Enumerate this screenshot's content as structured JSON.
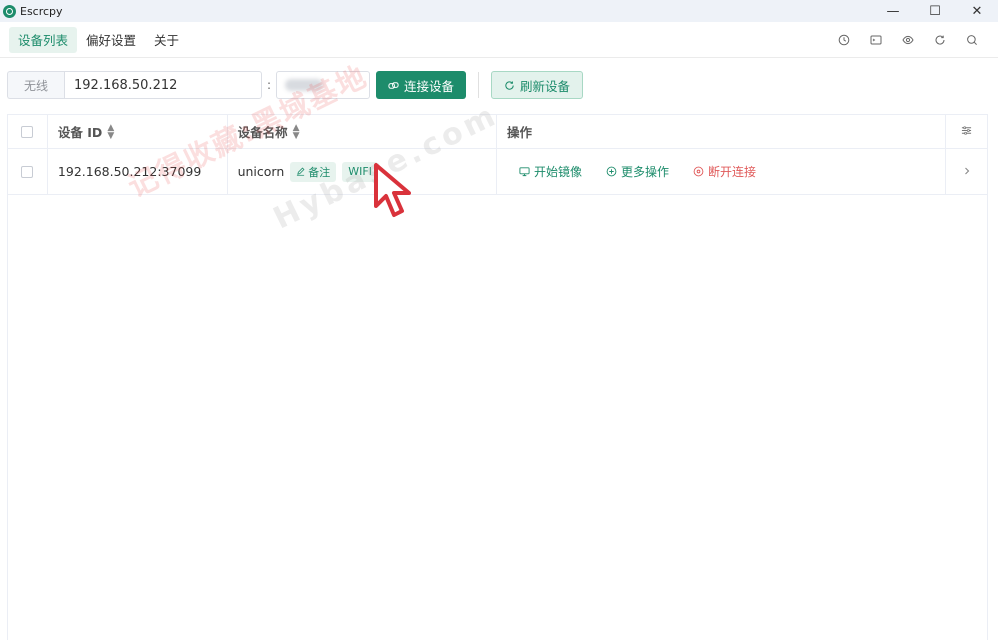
{
  "window": {
    "title": "Escrcpy",
    "minimize": "—",
    "maximize": "☐",
    "close": "✕"
  },
  "nav": {
    "tabs": [
      {
        "label": "设备列表",
        "active": true
      },
      {
        "label": "偏好设置",
        "active": false
      },
      {
        "label": "关于",
        "active": false
      }
    ],
    "icons": [
      "clock-icon",
      "terminal-icon",
      "eye-icon",
      "refresh-icon",
      "search-icon"
    ]
  },
  "toolbar": {
    "ip_prefix": "无线",
    "ip_value": "192.168.50.212",
    "colon": ":",
    "connect_label": "连接设备",
    "refresh_label": "刷新设备"
  },
  "table": {
    "headers": {
      "id": "设备 ID",
      "name": "设备名称",
      "ops": "操作"
    },
    "rows": [
      {
        "id": "192.168.50.212:37099",
        "name": "unicorn",
        "note_tag": "备注",
        "type_tag": "WIFI",
        "ops": {
          "mirror": "开始镜像",
          "more": "更多操作",
          "disconnect": "断开连接"
        }
      }
    ]
  },
  "watermark": {
    "text1": "记得收藏:黑域基地",
    "text2": "Hybase.com"
  },
  "colors": {
    "accent": "#1d8c6b",
    "danger": "#e05a5a",
    "tag_bg": "#e7f3ee"
  }
}
